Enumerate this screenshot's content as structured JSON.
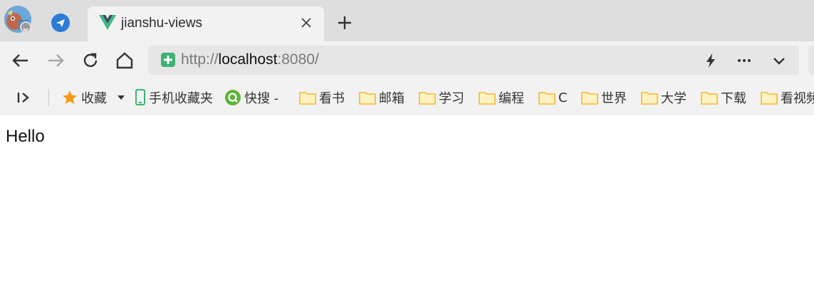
{
  "tab": {
    "title": "jianshu-views",
    "favicon": "vue-logo-icon"
  },
  "address": {
    "scheme": "http://",
    "host": "localhost",
    "rest": ":8080/"
  },
  "bookmarks": {
    "favorites_label": "收藏",
    "items": [
      {
        "label": "手机收藏夹",
        "icon": "phone-icon"
      },
      {
        "label": "快搜 -",
        "icon": "search-q-icon"
      },
      {
        "label": "看书",
        "icon": "folder-icon"
      },
      {
        "label": "邮箱",
        "icon": "folder-icon"
      },
      {
        "label": "学习",
        "icon": "folder-icon"
      },
      {
        "label": "编程",
        "icon": "folder-icon"
      },
      {
        "label": "C",
        "icon": "folder-icon"
      },
      {
        "label": "世界",
        "icon": "folder-icon"
      },
      {
        "label": "大学",
        "icon": "folder-icon"
      },
      {
        "label": "下载",
        "icon": "folder-icon"
      },
      {
        "label": "看视频",
        "icon": "folder-icon"
      }
    ]
  },
  "page": {
    "text": "Hello"
  },
  "colors": {
    "tabstrip": "#dedede",
    "toolbar": "#f2f2f2",
    "accent_green": "#3cb371",
    "folder": "#f5c242",
    "star": "#f39c12",
    "telegram": "#2c7bd6"
  }
}
